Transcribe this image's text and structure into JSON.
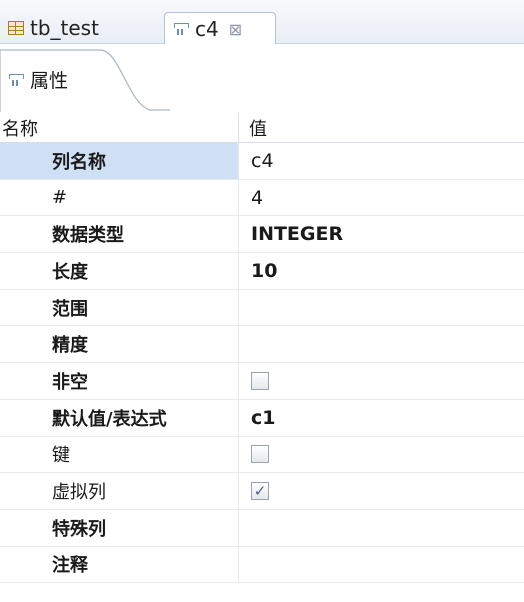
{
  "tabs": [
    {
      "label": "tb_test",
      "icon": "table-grid-icon"
    },
    {
      "label": "c4",
      "icon": "column-icon",
      "close_glyph": "⊠"
    }
  ],
  "property_tab": {
    "label": "属性",
    "icon": "column-icon"
  },
  "table": {
    "header": {
      "name": "名称",
      "value": "值"
    },
    "rows": [
      {
        "name": "列名称",
        "value": "c4",
        "name_bold": true,
        "value_bold": false,
        "selected": true
      },
      {
        "name": "#",
        "value": "4",
        "name_bold": false,
        "value_bold": false
      },
      {
        "name": "数据类型",
        "value": "INTEGER",
        "name_bold": true,
        "value_bold": true
      },
      {
        "name": "长度",
        "value": "10",
        "name_bold": true,
        "value_bold": true
      },
      {
        "name": "范围",
        "value": "",
        "name_bold": true
      },
      {
        "name": "精度",
        "value": "",
        "name_bold": true
      },
      {
        "name": "非空",
        "checkbox": true,
        "checked": false,
        "name_bold": true
      },
      {
        "name": "默认值/表达式",
        "value": "c1",
        "name_bold": true,
        "value_bold": true
      },
      {
        "name": "键",
        "checkbox": true,
        "checked": false,
        "name_bold": false
      },
      {
        "name": "虚拟列",
        "checkbox": true,
        "checked": true,
        "name_bold": false
      },
      {
        "name": "特殊列",
        "value": "",
        "name_bold": true
      },
      {
        "name": "注释",
        "value": "",
        "name_bold": true
      }
    ]
  },
  "colors": {
    "selection": "#cfe0f5",
    "check": "#4a5f8a"
  }
}
